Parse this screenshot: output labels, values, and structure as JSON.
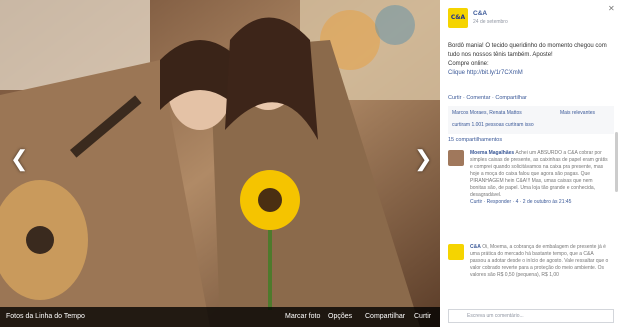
{
  "photo": {
    "bar": {
      "album": "Fotos da Linha do Tempo",
      "tag": "Marcar foto",
      "options": "Opções",
      "share": "Compartilhar",
      "like": "Curtir"
    }
  },
  "post": {
    "page_name": "C&A",
    "date": "24 de setembro",
    "logo": "C&A",
    "text": "Bordô mania! O tecido queridinho do momento chegou com tudo nos nossos tênis também. Aposte!",
    "sub": "Compre online:",
    "link": "Clique http://bit.ly/1r7CXmM",
    "actions": "Curtir · Comentar · Compartilhar",
    "likes_line": "Marcos Moraes, Renata Mattos",
    "likes_more": "Mais relevantes",
    "likes_count": "curtiram 1.001 pessoas curtiram isso",
    "shares": "15 compartilhamentos"
  },
  "comments": [
    {
      "name": "Moema Magalhães",
      "text": "Achei um ABSURDO a C&A cobrar por simples caixas de presente, as caixinhas de papel eram grátis e comprei quando solicitávamos na caixa pra presente, mas hoje a moça do caixa falou que agora são pagas. Que PIRANHAGEM hein C&A!!! Mas, umas caixas que nem bonitas são, de papel. Uma loja tão grande e conhecida, desagradável.",
      "meta": "Curtir · Responder · 4 · 2 de outubro às 21:45"
    },
    {
      "name": "C&A",
      "text": "Oi, Moema, a cobrança de embalagem de presente já é uma prática do mercado há bastante tempo, que a C&A passou a adotar desde o início de agosto. Vale ressaltar que o valor cobrado reverte para a proteção do meio ambiente. Os valores são R$ 0,50 (pequena), R$ 1,00"
    }
  ],
  "comment_placeholder": "Escreva um comentário...",
  "colors": {
    "brand_yellow": "#f5d400",
    "fb_blue": "#3b5998"
  }
}
